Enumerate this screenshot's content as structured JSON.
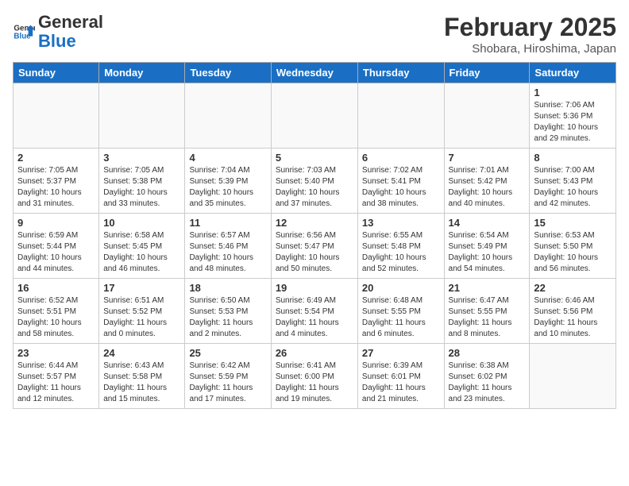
{
  "logo": {
    "text_general": "General",
    "text_blue": "Blue"
  },
  "header": {
    "title": "February 2025",
    "subtitle": "Shobara, Hiroshima, Japan"
  },
  "weekdays": [
    "Sunday",
    "Monday",
    "Tuesday",
    "Wednesday",
    "Thursday",
    "Friday",
    "Saturday"
  ],
  "weeks": [
    [
      {
        "day": "",
        "info": ""
      },
      {
        "day": "",
        "info": ""
      },
      {
        "day": "",
        "info": ""
      },
      {
        "day": "",
        "info": ""
      },
      {
        "day": "",
        "info": ""
      },
      {
        "day": "",
        "info": ""
      },
      {
        "day": "1",
        "info": "Sunrise: 7:06 AM\nSunset: 5:36 PM\nDaylight: 10 hours and 29 minutes."
      }
    ],
    [
      {
        "day": "2",
        "info": "Sunrise: 7:05 AM\nSunset: 5:37 PM\nDaylight: 10 hours and 31 minutes."
      },
      {
        "day": "3",
        "info": "Sunrise: 7:05 AM\nSunset: 5:38 PM\nDaylight: 10 hours and 33 minutes."
      },
      {
        "day": "4",
        "info": "Sunrise: 7:04 AM\nSunset: 5:39 PM\nDaylight: 10 hours and 35 minutes."
      },
      {
        "day": "5",
        "info": "Sunrise: 7:03 AM\nSunset: 5:40 PM\nDaylight: 10 hours and 37 minutes."
      },
      {
        "day": "6",
        "info": "Sunrise: 7:02 AM\nSunset: 5:41 PM\nDaylight: 10 hours and 38 minutes."
      },
      {
        "day": "7",
        "info": "Sunrise: 7:01 AM\nSunset: 5:42 PM\nDaylight: 10 hours and 40 minutes."
      },
      {
        "day": "8",
        "info": "Sunrise: 7:00 AM\nSunset: 5:43 PM\nDaylight: 10 hours and 42 minutes."
      }
    ],
    [
      {
        "day": "9",
        "info": "Sunrise: 6:59 AM\nSunset: 5:44 PM\nDaylight: 10 hours and 44 minutes."
      },
      {
        "day": "10",
        "info": "Sunrise: 6:58 AM\nSunset: 5:45 PM\nDaylight: 10 hours and 46 minutes."
      },
      {
        "day": "11",
        "info": "Sunrise: 6:57 AM\nSunset: 5:46 PM\nDaylight: 10 hours and 48 minutes."
      },
      {
        "day": "12",
        "info": "Sunrise: 6:56 AM\nSunset: 5:47 PM\nDaylight: 10 hours and 50 minutes."
      },
      {
        "day": "13",
        "info": "Sunrise: 6:55 AM\nSunset: 5:48 PM\nDaylight: 10 hours and 52 minutes."
      },
      {
        "day": "14",
        "info": "Sunrise: 6:54 AM\nSunset: 5:49 PM\nDaylight: 10 hours and 54 minutes."
      },
      {
        "day": "15",
        "info": "Sunrise: 6:53 AM\nSunset: 5:50 PM\nDaylight: 10 hours and 56 minutes."
      }
    ],
    [
      {
        "day": "16",
        "info": "Sunrise: 6:52 AM\nSunset: 5:51 PM\nDaylight: 10 hours and 58 minutes."
      },
      {
        "day": "17",
        "info": "Sunrise: 6:51 AM\nSunset: 5:52 PM\nDaylight: 11 hours and 0 minutes."
      },
      {
        "day": "18",
        "info": "Sunrise: 6:50 AM\nSunset: 5:53 PM\nDaylight: 11 hours and 2 minutes."
      },
      {
        "day": "19",
        "info": "Sunrise: 6:49 AM\nSunset: 5:54 PM\nDaylight: 11 hours and 4 minutes."
      },
      {
        "day": "20",
        "info": "Sunrise: 6:48 AM\nSunset: 5:55 PM\nDaylight: 11 hours and 6 minutes."
      },
      {
        "day": "21",
        "info": "Sunrise: 6:47 AM\nSunset: 5:55 PM\nDaylight: 11 hours and 8 minutes."
      },
      {
        "day": "22",
        "info": "Sunrise: 6:46 AM\nSunset: 5:56 PM\nDaylight: 11 hours and 10 minutes."
      }
    ],
    [
      {
        "day": "23",
        "info": "Sunrise: 6:44 AM\nSunset: 5:57 PM\nDaylight: 11 hours and 12 minutes."
      },
      {
        "day": "24",
        "info": "Sunrise: 6:43 AM\nSunset: 5:58 PM\nDaylight: 11 hours and 15 minutes."
      },
      {
        "day": "25",
        "info": "Sunrise: 6:42 AM\nSunset: 5:59 PM\nDaylight: 11 hours and 17 minutes."
      },
      {
        "day": "26",
        "info": "Sunrise: 6:41 AM\nSunset: 6:00 PM\nDaylight: 11 hours and 19 minutes."
      },
      {
        "day": "27",
        "info": "Sunrise: 6:39 AM\nSunset: 6:01 PM\nDaylight: 11 hours and 21 minutes."
      },
      {
        "day": "28",
        "info": "Sunrise: 6:38 AM\nSunset: 6:02 PM\nDaylight: 11 hours and 23 minutes."
      },
      {
        "day": "",
        "info": ""
      }
    ]
  ]
}
